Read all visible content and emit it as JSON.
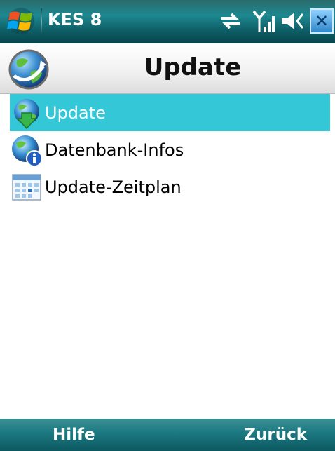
{
  "statusbar": {
    "app_title": "KES 8",
    "icons": [
      "windows-start-icon",
      "sync-icon",
      "signal-icon",
      "speaker-icon",
      "close-icon"
    ],
    "close_label": "✕"
  },
  "header": {
    "title": "Update",
    "icon": "globe-update-icon"
  },
  "list": {
    "items": [
      {
        "label": "Update",
        "icon": "update-download-icon",
        "selected": true
      },
      {
        "label": "Datenbank-Infos",
        "icon": "database-info-icon",
        "selected": false
      },
      {
        "label": "Update-Zeitplan",
        "icon": "schedule-calendar-icon",
        "selected": false
      }
    ]
  },
  "softkeys": {
    "left": "Hilfe",
    "right": "Zurück"
  },
  "colors": {
    "selection": "#33c7d8",
    "statusbar": "#1e8890",
    "softbar": "#1e7b83"
  }
}
